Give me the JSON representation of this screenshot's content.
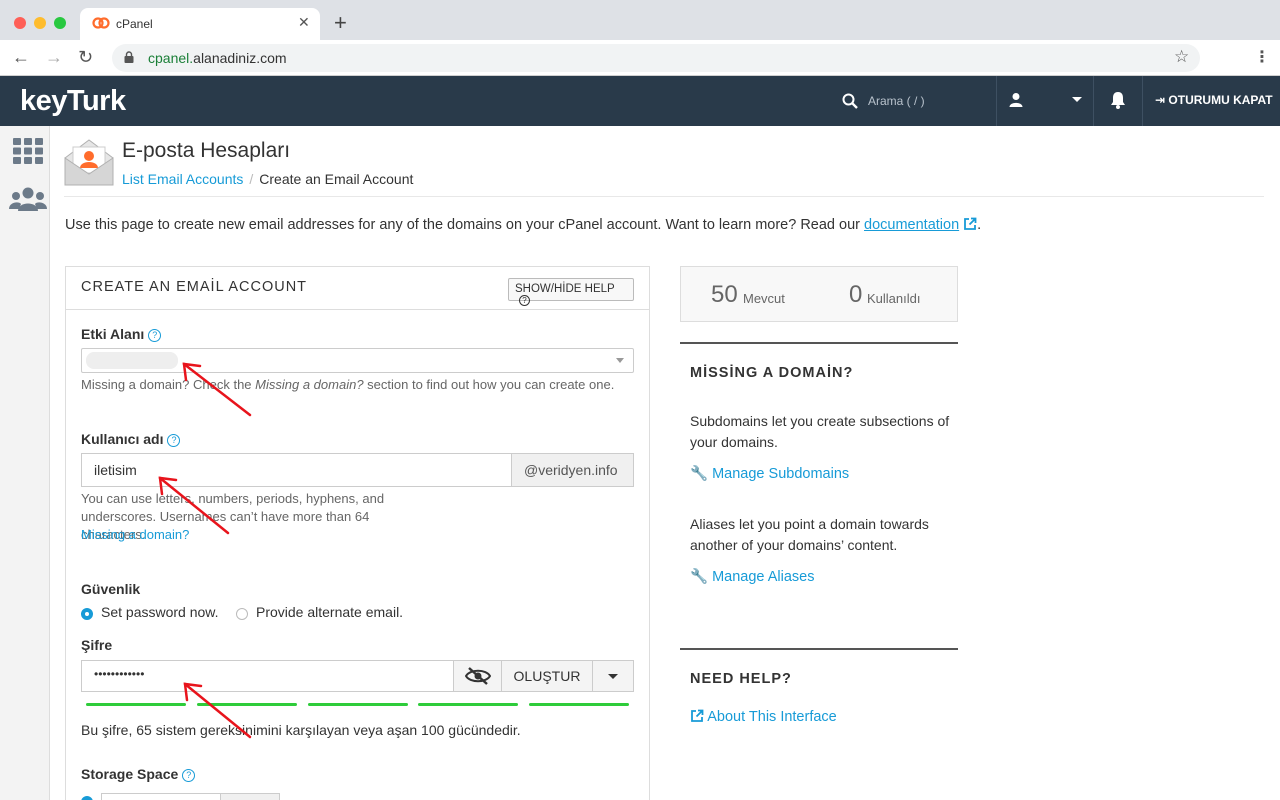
{
  "browser": {
    "tab_title": "cPanel",
    "tab_icon": "cpanel-logo-icon",
    "url_domain": "cpanel.",
    "url_rest": "alanadiniz.com"
  },
  "header": {
    "brand": "keyTurk",
    "search_placeholder": "Arama ( / )",
    "logout_label": "OTURUMU KAPAT"
  },
  "page": {
    "title": "E-posta Hesapları",
    "breadcrumb_link": "List Email Accounts",
    "breadcrumb_sep": "/",
    "breadcrumb_current": "Create an Email Account",
    "intro_text": "Use this page to create new email addresses for any of the domains on your cPanel account. Want to learn more? Read our",
    "intro_link": "documentation",
    "intro_end": "."
  },
  "form": {
    "panel_title": "CREATE AN EMAİL ACCOUNT",
    "help_button": "SHOW/HİDE HELP",
    "domain_label": "Etki Alanı",
    "domain_help_1": "Missing a domain? Check the ",
    "domain_help_em": "Missing a domain?",
    "domain_help_2": " section to find out how you can create one.",
    "username_label": "Kullanıcı adı",
    "username_value": "iletisim",
    "username_suffix": "@veridyen.info",
    "username_help": "You can use letters, numbers, periods, hyphens, and underscores. Usernames can’t have more than 64 characters.",
    "username_link": "Missing a domain?",
    "security_label": "Güvenlik",
    "radio_set_password": "Set password now.",
    "radio_alt_email": "Provide alternate email.",
    "password_label": "Şifre",
    "password_value": "••••••••••••",
    "generate_button": "OLUŞTUR",
    "strength_text": "Bu şifre, 65 sistem gereksinimini karşılayan veya aşan 100 gücündedir.",
    "strength_value": 100,
    "storage_label": "Storage Space"
  },
  "side": {
    "available_count": "50",
    "available_label": "Mevcut",
    "used_count": "0",
    "used_label": "Kullanıldı",
    "missing_title": "MİSSİNG A DOMAİN?",
    "subdomains_text": "Subdomains let you create subsections of your domains.",
    "subdomains_link": "Manage Subdomains",
    "aliases_text": "Aliases let you point a domain towards another of your domains’ content.",
    "aliases_link": "Manage Aliases",
    "help_title": "NEED HELP?",
    "about_link": "About This Interface"
  },
  "colors": {
    "header_bg": "#293a4a",
    "link": "#179bd7",
    "strength_bar": "#2ecc3a",
    "arrow": "#e8141c"
  }
}
